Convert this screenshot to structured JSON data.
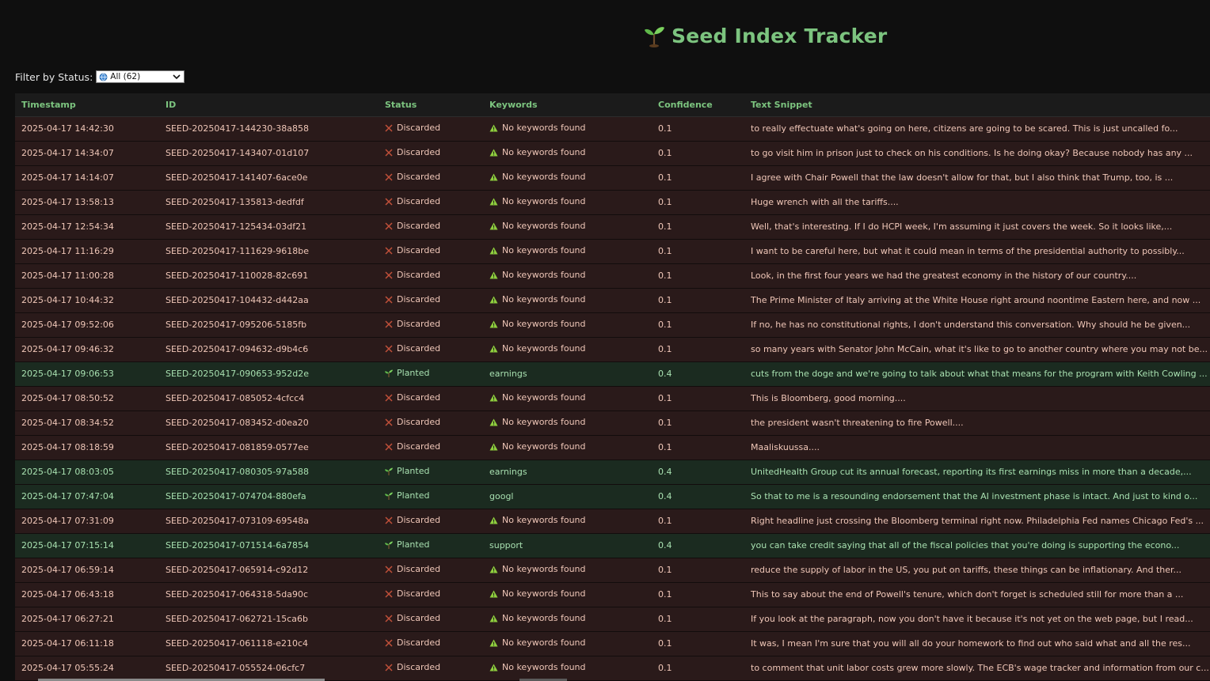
{
  "app": {
    "title": "Seed Index Tracker"
  },
  "filter": {
    "label": "Filter by Status:",
    "selected": "All (62)"
  },
  "table": {
    "columns": [
      "Timestamp",
      "ID",
      "Status",
      "Keywords",
      "Confidence",
      "Text Snippet"
    ],
    "rows": [
      {
        "timestamp": "2025-04-17 14:42:30",
        "id": "SEED-20250417-144230-38a858",
        "status": "Discarded",
        "keywords": "No keywords found",
        "confidence": "0.1",
        "snippet": "to really effectuate what's going on here, citizens are going to be scared. This is just uncalled fo..."
      },
      {
        "timestamp": "2025-04-17 14:34:07",
        "id": "SEED-20250417-143407-01d107",
        "status": "Discarded",
        "keywords": "No keywords found",
        "confidence": "0.1",
        "snippet": "to go visit him in prison just to check on his conditions. Is he doing okay? Because nobody has any ..."
      },
      {
        "timestamp": "2025-04-17 14:14:07",
        "id": "SEED-20250417-141407-6ace0e",
        "status": "Discarded",
        "keywords": "No keywords found",
        "confidence": "0.1",
        "snippet": "I agree with Chair Powell that the law doesn't allow for that, but I also think that Trump, too, is ..."
      },
      {
        "timestamp": "2025-04-17 13:58:13",
        "id": "SEED-20250417-135813-dedfdf",
        "status": "Discarded",
        "keywords": "No keywords found",
        "confidence": "0.1",
        "snippet": "Huge wrench with all the tariffs...."
      },
      {
        "timestamp": "2025-04-17 12:54:34",
        "id": "SEED-20250417-125434-03df21",
        "status": "Discarded",
        "keywords": "No keywords found",
        "confidence": "0.1",
        "snippet": "Well, that's interesting. If I do HCPI week, I'm assuming it just covers the week. So it looks like,..."
      },
      {
        "timestamp": "2025-04-17 11:16:29",
        "id": "SEED-20250417-111629-9618be",
        "status": "Discarded",
        "keywords": "No keywords found",
        "confidence": "0.1",
        "snippet": "I want to be careful here, but what it could mean in terms of the presidential authority to possibly..."
      },
      {
        "timestamp": "2025-04-17 11:00:28",
        "id": "SEED-20250417-110028-82c691",
        "status": "Discarded",
        "keywords": "No keywords found",
        "confidence": "0.1",
        "snippet": "Look, in the first four years we had the greatest economy in the history of our country...."
      },
      {
        "timestamp": "2025-04-17 10:44:32",
        "id": "SEED-20250417-104432-d442aa",
        "status": "Discarded",
        "keywords": "No keywords found",
        "confidence": "0.1",
        "snippet": "The Prime Minister of Italy arriving at the White House right around noontime Eastern here, and now ..."
      },
      {
        "timestamp": "2025-04-17 09:52:06",
        "id": "SEED-20250417-095206-5185fb",
        "status": "Discarded",
        "keywords": "No keywords found",
        "confidence": "0.1",
        "snippet": "If no, he has no constitutional rights, I don't understand this conversation. Why should he be given..."
      },
      {
        "timestamp": "2025-04-17 09:46:32",
        "id": "SEED-20250417-094632-d9b4c6",
        "status": "Discarded",
        "keywords": "No keywords found",
        "confidence": "0.1",
        "snippet": "so many years with Senator John McCain, what it's like to go to another country where you may not be..."
      },
      {
        "timestamp": "2025-04-17 09:06:53",
        "id": "SEED-20250417-090653-952d2e",
        "status": "Planted",
        "keywords": "earnings",
        "confidence": "0.4",
        "snippet": "cuts from the doge and we're going to talk about what that means for the program with Keith Cowling ..."
      },
      {
        "timestamp": "2025-04-17 08:50:52",
        "id": "SEED-20250417-085052-4cfcc4",
        "status": "Discarded",
        "keywords": "No keywords found",
        "confidence": "0.1",
        "snippet": "This is Bloomberg, good morning...."
      },
      {
        "timestamp": "2025-04-17 08:34:52",
        "id": "SEED-20250417-083452-d0ea20",
        "status": "Discarded",
        "keywords": "No keywords found",
        "confidence": "0.1",
        "snippet": "the president wasn't threatening to fire Powell...."
      },
      {
        "timestamp": "2025-04-17 08:18:59",
        "id": "SEED-20250417-081859-0577ee",
        "status": "Discarded",
        "keywords": "No keywords found",
        "confidence": "0.1",
        "snippet": "Maaliskuussa...."
      },
      {
        "timestamp": "2025-04-17 08:03:05",
        "id": "SEED-20250417-080305-97a588",
        "status": "Planted",
        "keywords": "earnings",
        "confidence": "0.4",
        "snippet": "UnitedHealth Group cut its annual forecast, reporting its first earnings miss in more than a decade,..."
      },
      {
        "timestamp": "2025-04-17 07:47:04",
        "id": "SEED-20250417-074704-880efa",
        "status": "Planted",
        "keywords": "googl",
        "confidence": "0.4",
        "snippet": "So that to me is a resounding endorsement that the AI investment phase is intact. And just to kind o..."
      },
      {
        "timestamp": "2025-04-17 07:31:09",
        "id": "SEED-20250417-073109-69548a",
        "status": "Discarded",
        "keywords": "No keywords found",
        "confidence": "0.1",
        "snippet": "Right headline just crossing the Bloomberg terminal right now. Philadelphia Fed names Chicago Fed's ..."
      },
      {
        "timestamp": "2025-04-17 07:15:14",
        "id": "SEED-20250417-071514-6a7854",
        "status": "Planted",
        "keywords": "support",
        "confidence": "0.4",
        "snippet": "you can take credit saying that all of the fiscal policies that you're doing is supporting the econo..."
      },
      {
        "timestamp": "2025-04-17 06:59:14",
        "id": "SEED-20250417-065914-c92d12",
        "status": "Discarded",
        "keywords": "No keywords found",
        "confidence": "0.1",
        "snippet": "reduce the supply of labor in the US, you put on tariffs, these things can be inflationary. And ther..."
      },
      {
        "timestamp": "2025-04-17 06:43:18",
        "id": "SEED-20250417-064318-5da90c",
        "status": "Discarded",
        "keywords": "No keywords found",
        "confidence": "0.1",
        "snippet": "This to say about the end of Powell's tenure, which don't forget is scheduled still for more than a ..."
      },
      {
        "timestamp": "2025-04-17 06:27:21",
        "id": "SEED-20250417-062721-15ca6b",
        "status": "Discarded",
        "keywords": "No keywords found",
        "confidence": "0.1",
        "snippet": "If you look at the paragraph, now you don't have it because it's not yet on the web page, but I read..."
      },
      {
        "timestamp": "2025-04-17 06:11:18",
        "id": "SEED-20250417-061118-e210c4",
        "status": "Discarded",
        "keywords": "No keywords found",
        "confidence": "0.1",
        "snippet": "It was, I mean I'm sure that you will all do your homework to find out who said what and all the res..."
      },
      {
        "timestamp": "2025-04-17 05:55:24",
        "id": "SEED-20250417-055524-06cfc7",
        "status": "Discarded",
        "keywords": "No keywords found",
        "confidence": "0.1",
        "snippet": "to comment that unit labor costs grew more slowly. The ECB's wage tracker and information from our c..."
      }
    ]
  },
  "icons": {
    "title": "seedling-icon",
    "discarded": "x-icon",
    "planted": "seedling-icon",
    "no_keywords": "warning-icon",
    "filter": "globe-icon"
  },
  "colors": {
    "accent_green": "#7cc47f",
    "discarded_row": "#2a1a1a",
    "planted_row": "#1b2b20",
    "warning": "#8fce3e",
    "discard_x": "#c0503a"
  }
}
